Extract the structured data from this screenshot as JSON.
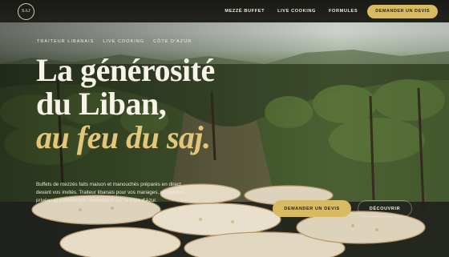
{
  "logo": {
    "text": "SAJ"
  },
  "nav": {
    "links": [
      {
        "label": "MEZZÉ BUFFET"
      },
      {
        "label": "LIVE COOKING"
      },
      {
        "label": "FORMULES"
      }
    ],
    "cta_label": "DEMANDER UN DEVIS"
  },
  "hero": {
    "eyebrow": {
      "items": [
        "TRAITEUR LIBANAIS",
        "LIVE COOKING",
        "CÔTE D'AZUR"
      ],
      "separator": "·"
    },
    "title": {
      "line1": "La générosité",
      "line2": "du Liban,",
      "line3": "au feu du saj."
    },
    "description": "Buffets de mezzés faits maison et manouchés préparés en direct devant vos invités. Traiteur libanais pour vos mariages, réceptions privées et événements d'entreprise sur la Côte d'Azur.",
    "primary_button": "DEMANDER UN DEVIS",
    "secondary_button": "DÉCOUVRIR"
  },
  "colors": {
    "accent": "#d8ba63",
    "accent_text": "#e2c67a",
    "nav_bg": "#1a1a16",
    "text_light": "#f7f3e9"
  }
}
